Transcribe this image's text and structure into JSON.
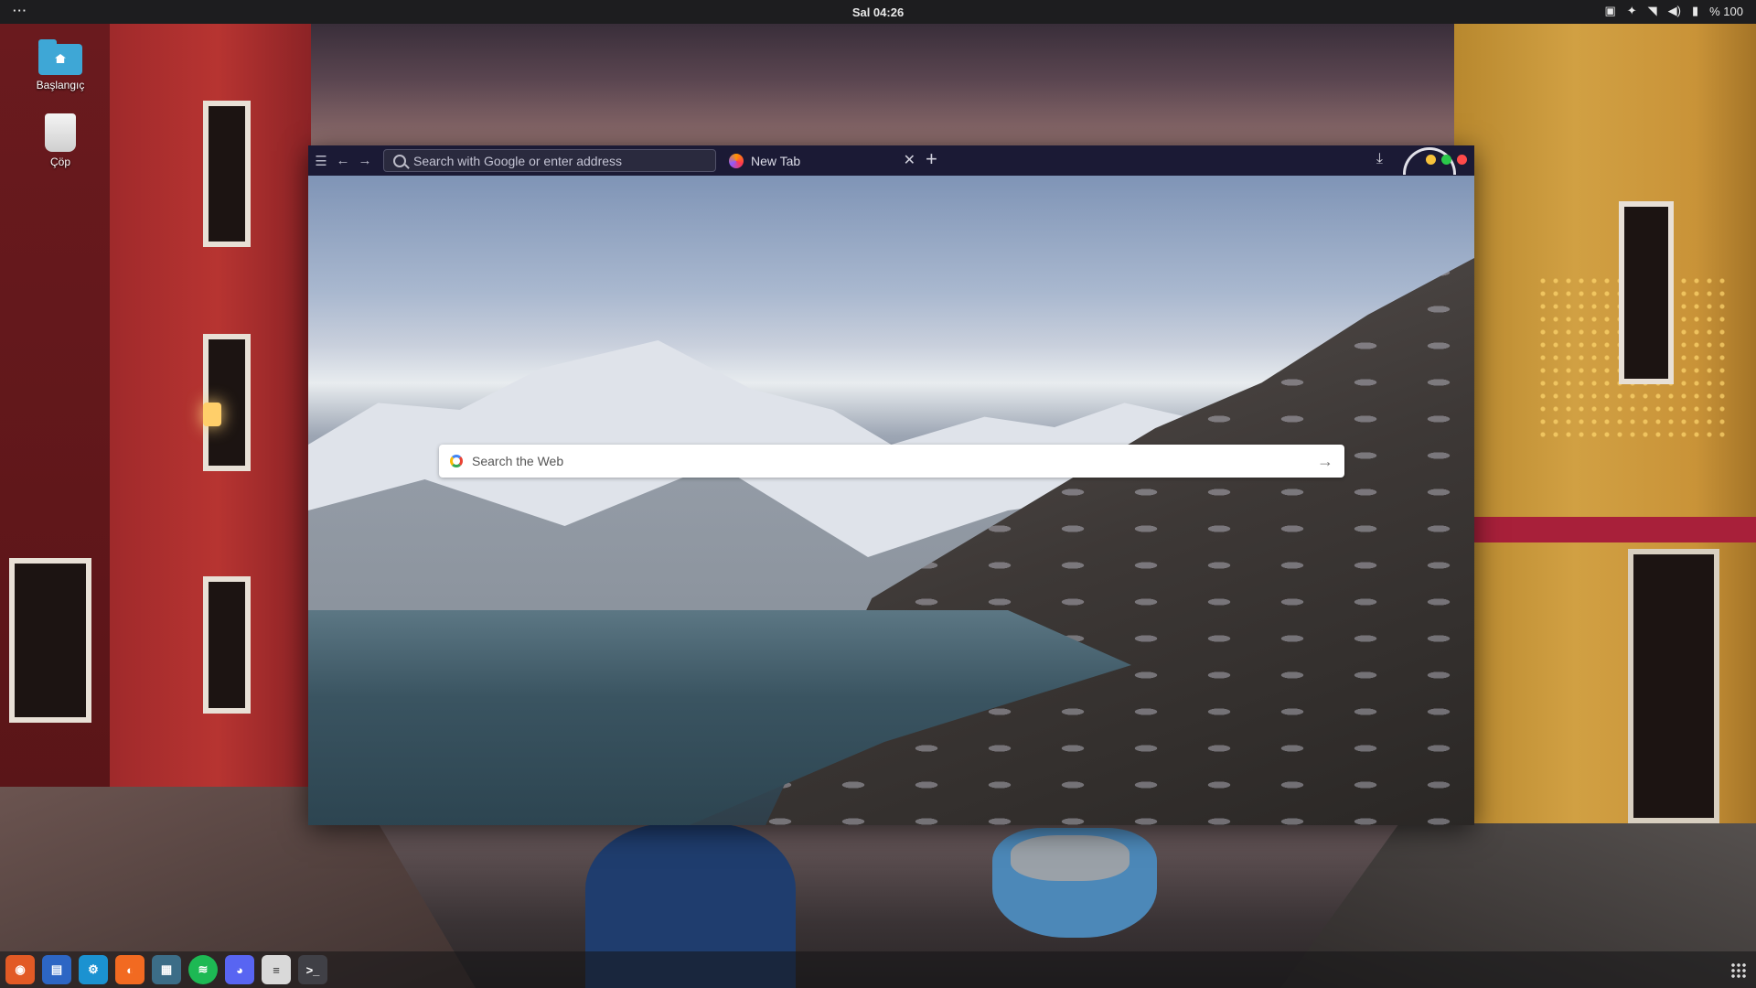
{
  "topbar": {
    "menu_dots": "···",
    "clock": "Sal 04:26",
    "battery_pct": "% 100",
    "icons": [
      "screenshot-icon",
      "brightness-icon",
      "wifi-icon",
      "volume-icon",
      "battery-icon"
    ]
  },
  "desktop": {
    "icons": [
      {
        "label": "Başlangıç",
        "icon": "home-folder-icon"
      },
      {
        "label": "Çöp",
        "icon": "trash-icon"
      }
    ]
  },
  "browser": {
    "url_placeholder": "Search with Google or enter address",
    "tab_title": "New Tab",
    "tab_close": "✕",
    "new_tab": "+",
    "search_placeholder": "Search the Web",
    "colors": {
      "toolbar": "#1b1a35",
      "close": "#ff4a4a",
      "min": "#f7c23b",
      "max": "#2ac84a"
    }
  },
  "dock": {
    "apps": [
      {
        "name": "firefox",
        "color": "#e25a25"
      },
      {
        "name": "files",
        "color": "#2d66c4"
      },
      {
        "name": "settings",
        "color": "#1b92d1"
      },
      {
        "name": "software",
        "color": "#f26a21"
      },
      {
        "name": "system-monitor",
        "color": "#3c6d87"
      },
      {
        "name": "spotify",
        "color": "#1db954"
      },
      {
        "name": "discord",
        "color": "#5865f2"
      },
      {
        "name": "text-editor",
        "color": "#d9d9d9"
      },
      {
        "name": "terminal",
        "color": "#404046"
      }
    ]
  }
}
